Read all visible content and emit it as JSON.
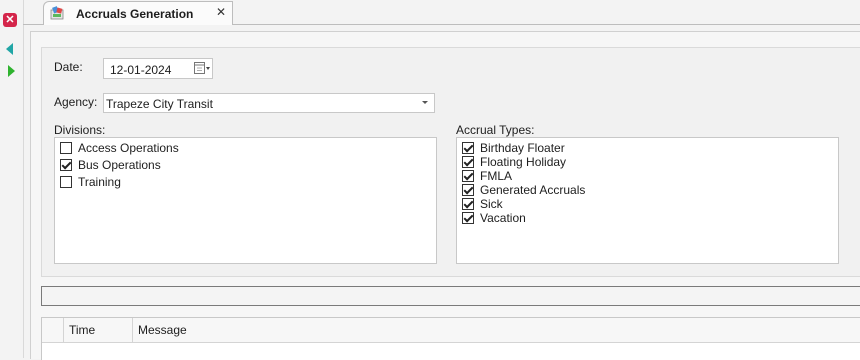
{
  "sidebar": {
    "close_icon": "close-icon",
    "back_icon": "arrow-left-icon",
    "forward_icon": "arrow-right-icon"
  },
  "tab": {
    "title": "Accruals Generation",
    "close": "✕"
  },
  "form": {
    "date_label": "Date:",
    "date_value": "12-01-2024",
    "agency_label": "Agency:",
    "agency_value": "Trapeze City Transit",
    "divisions_label": "Divisions:",
    "divisions": [
      {
        "label": "Access Operations",
        "checked": false
      },
      {
        "label": "Bus Operations",
        "checked": true
      },
      {
        "label": "Training",
        "checked": false
      }
    ],
    "accrual_types_label": "Accrual Types:",
    "accrual_types": [
      {
        "label": "Birthday Floater",
        "checked": true
      },
      {
        "label": "Floating Holiday",
        "checked": true
      },
      {
        "label": "FMLA",
        "checked": true
      },
      {
        "label": "Generated Accruals",
        "checked": true
      },
      {
        "label": "Sick",
        "checked": true
      },
      {
        "label": "Vacation",
        "checked": true
      }
    ]
  },
  "log": {
    "columns": [
      "Time",
      "Message"
    ]
  },
  "colors": {
    "close_red": "#d4254a",
    "back_teal": "#21a6a6",
    "forward_green": "#2fb32f"
  }
}
